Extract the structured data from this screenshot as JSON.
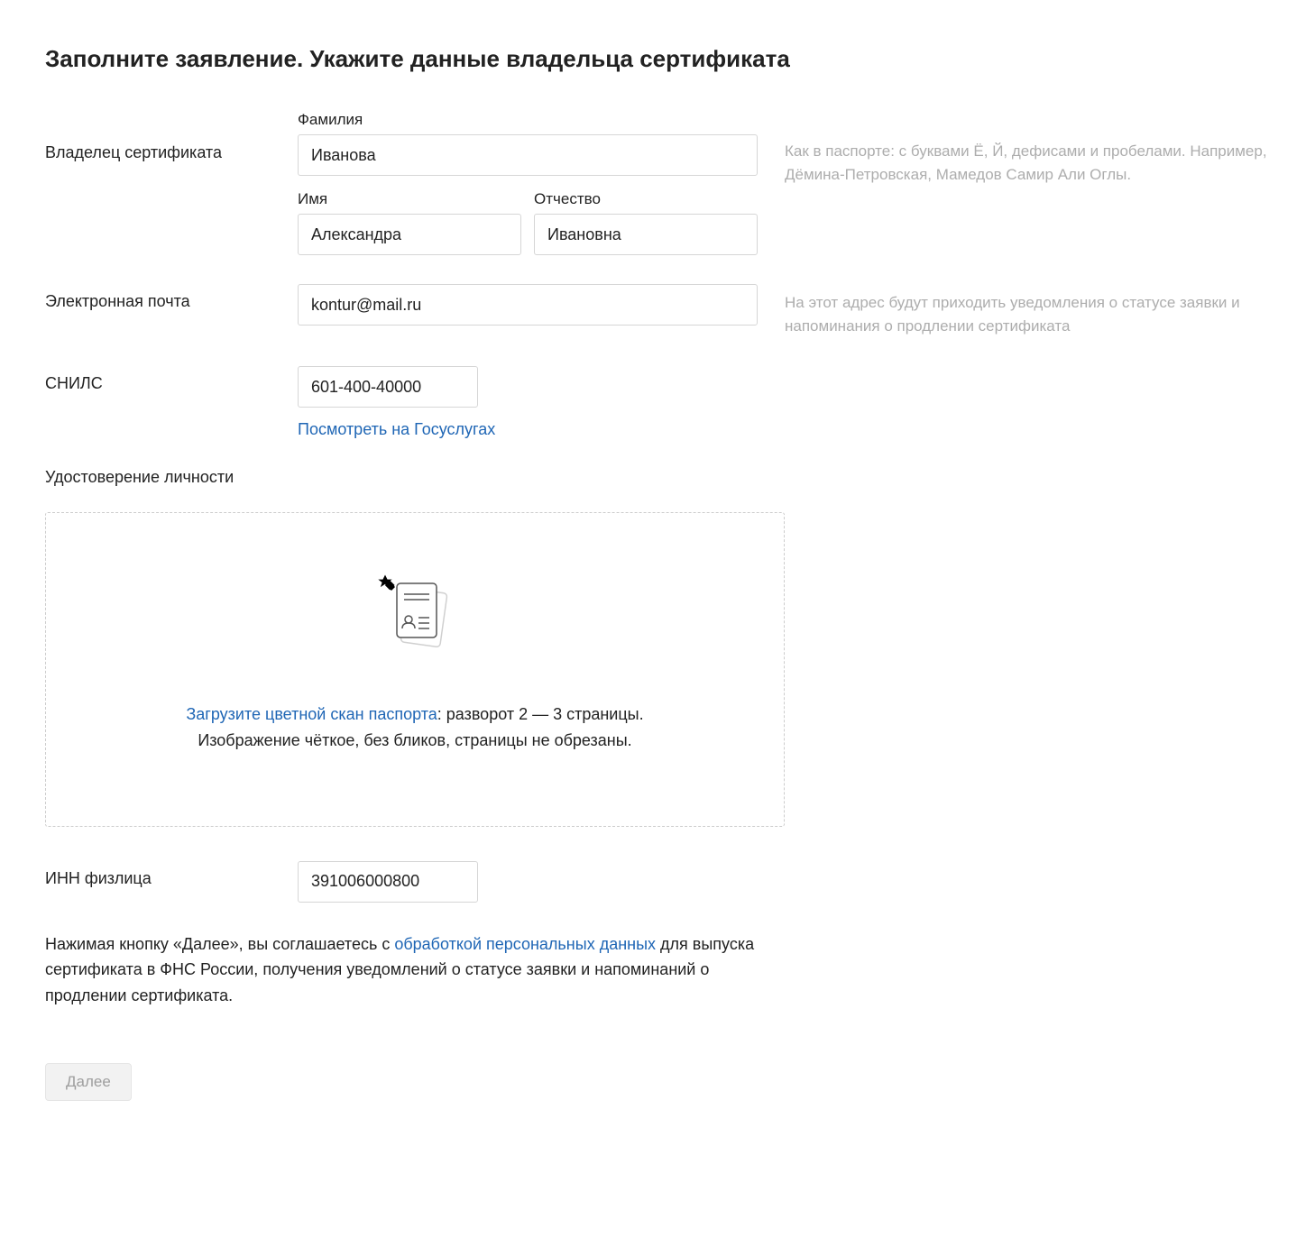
{
  "heading": "Заполните заявление. Укажите данные владельца сертификата",
  "owner": {
    "row_label": "Владелец сертификата",
    "surname_label": "Фамилия",
    "surname_value": "Иванова",
    "name_label": "Имя",
    "name_value": "Александра",
    "patronymic_label": "Отчество",
    "patronymic_value": "Ивановна",
    "hint": "Как в паспорте: с буквами Ё, Й, дефисами и пробелами. Например, Дёмина-Петровская, Мамедов Самир Али Оглы."
  },
  "email": {
    "row_label": "Электронная почта",
    "value": "kontur@mail.ru",
    "hint": "На этот адрес будут приходить уведомления о статусе заявки и напоминания о продлении сертификата"
  },
  "snils": {
    "row_label": "СНИЛС",
    "value": "601-400-40000",
    "gos_link": "Посмотреть на Госуслугах"
  },
  "identity": {
    "section_title": "Удостоверение личности",
    "upload_link": "Загрузите цветной скан паспорта",
    "upload_tail": ": разворот 2 — 3 страницы.",
    "upload_line2": "Изображение чёткое, без бликов, страницы не обрезаны."
  },
  "inn": {
    "row_label": "ИНН физлица",
    "value": "391006000800"
  },
  "consent": {
    "part1": "Нажимая кнопку «Далее», вы соглашаетесь с ",
    "link": "обработкой персональных данных",
    "part2": " для выпуска сертификата в ФНС России, получения уведомлений о статусе заявки и напоминаний о продлении сертификата."
  },
  "next_button": "Далее"
}
